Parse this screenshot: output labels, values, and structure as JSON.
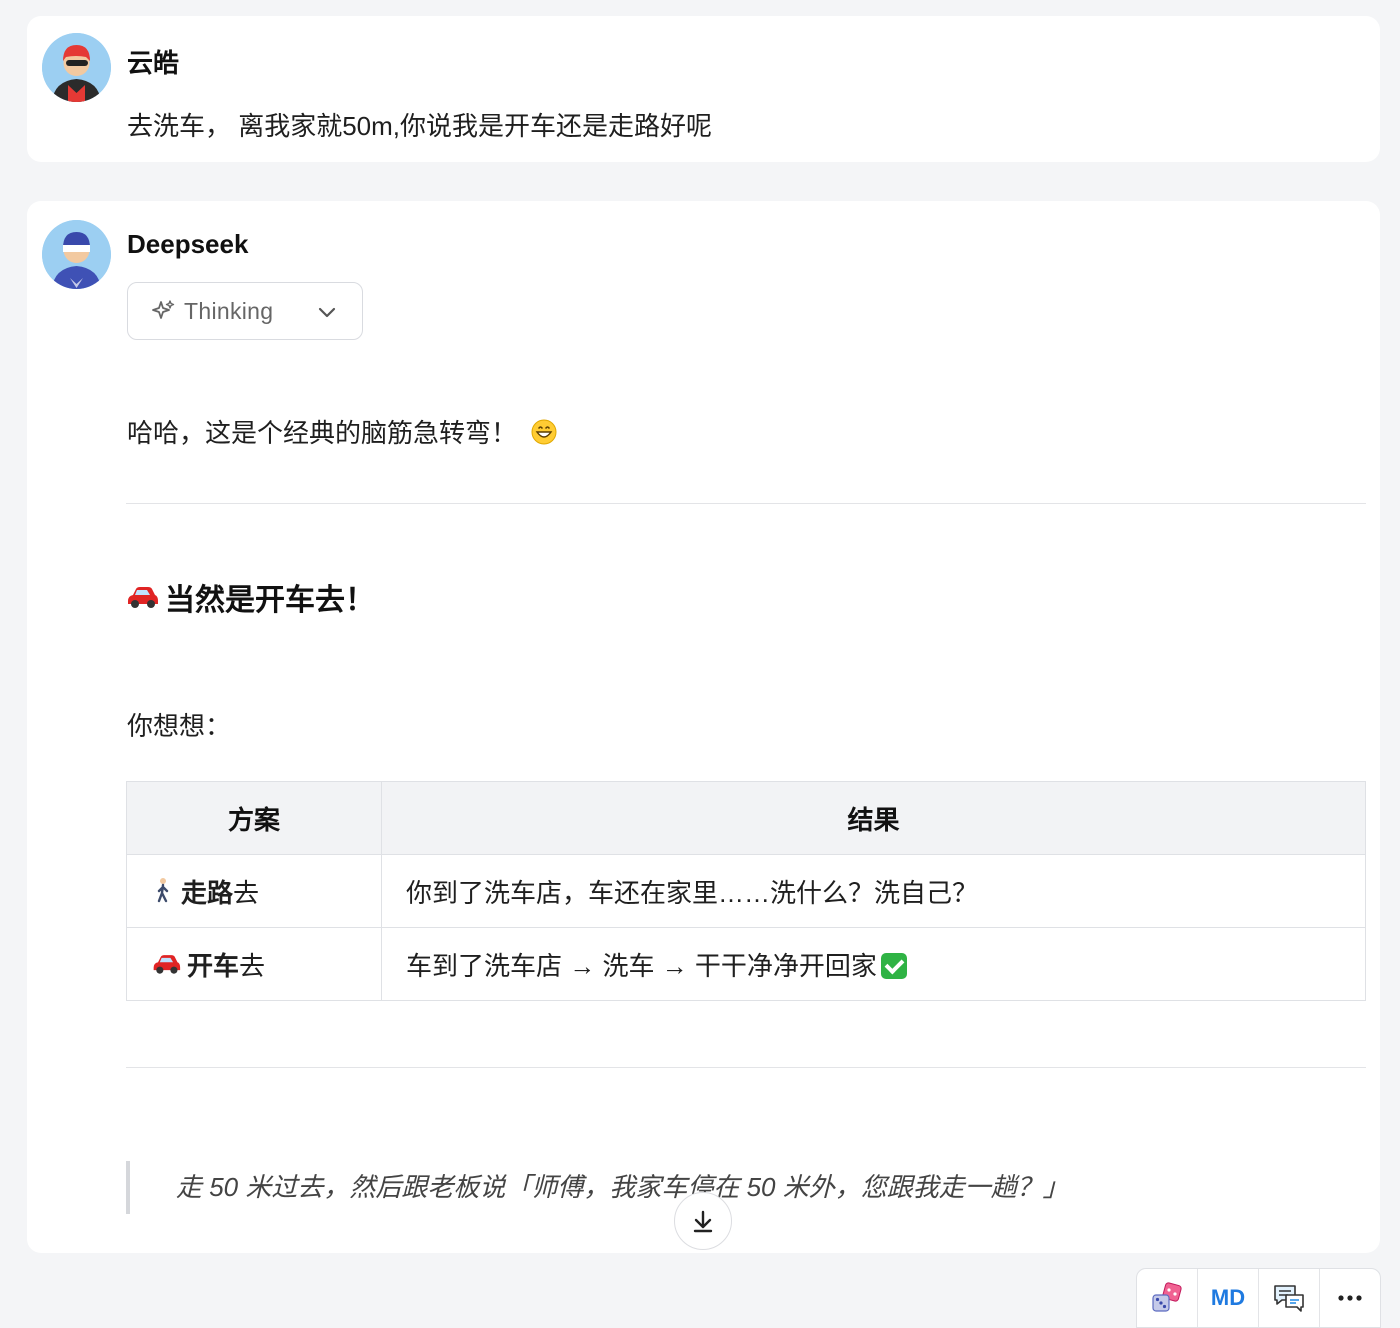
{
  "messages": {
    "user": {
      "name": "云皓",
      "text": "去洗车， 离我家就50m,你说我是开车还是走路好呢"
    },
    "assistant": {
      "name": "Deepseek",
      "thinking_label": "Thinking",
      "intro": "哈哈，这是个经典的脑筋急转弯！",
      "heading": "当然是开车去！",
      "lead": "你想想：",
      "table": {
        "headers": [
          "方案",
          "结果"
        ],
        "rows": [
          {
            "option_bold": "走路",
            "option_rest": "去",
            "result": "你到了洗车店，车还在家里……洗什么？洗自己？"
          },
          {
            "option_bold": "开车",
            "option_rest": "去",
            "result": "车到了洗车店 → 洗车 → 干干净净开回家"
          }
        ]
      },
      "quote": "走 50 米过去，然后跟老板说「师傅，我家车停在 50 米外，您跟我走一趟？」"
    }
  },
  "toolbar": {
    "md_label": "MD"
  },
  "icons": {
    "user_avatar": "user-avatar-red-hair",
    "assistant_avatar": "assistant-avatar-blue",
    "thinking": "sparkle-icon",
    "chevron": "chevron-down-icon",
    "grin": "grinning-face-emoji",
    "car": "red-car-emoji",
    "walker": "person-walking-emoji",
    "check": "check-mark-button-emoji",
    "scroll": "arrow-down-icon",
    "dice": "dice-icon",
    "chat": "chat-bubbles-icon",
    "more": "more-dots-icon"
  }
}
